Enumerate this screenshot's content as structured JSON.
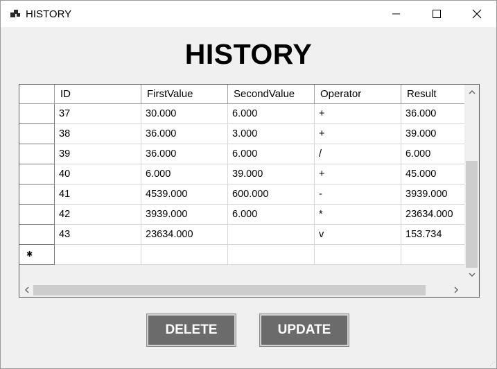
{
  "window": {
    "title": "HISTORY"
  },
  "heading": "HISTORY",
  "table": {
    "columns": [
      "ID",
      "FirstValue",
      "SecondValue",
      "Operator",
      "Result"
    ],
    "rows": [
      [
        "37",
        "30.000",
        "6.000",
        "+",
        "36.000"
      ],
      [
        "38",
        "36.000",
        "3.000",
        "+",
        "39.000"
      ],
      [
        "39",
        "36.000",
        "6.000",
        "/",
        "6.000"
      ],
      [
        "40",
        "6.000",
        "39.000",
        "+",
        "45.000"
      ],
      [
        "41",
        "4539.000",
        "600.000",
        "-",
        "3939.000"
      ],
      [
        "42",
        "3939.000",
        "6.000",
        "*",
        "23634.000"
      ],
      [
        "43",
        "23634.000",
        "",
        "v",
        "153.734"
      ]
    ],
    "new_row_marker": "✱"
  },
  "buttons": {
    "delete_label": "DELETE",
    "update_label": "UPDATE"
  },
  "icons": {
    "app": "app-icon",
    "minimize": "minimize-icon",
    "maximize": "maximize-icon",
    "close": "close-icon",
    "scroll_up": "chevron-up-icon",
    "scroll_down": "chevron-down-icon",
    "scroll_left": "chevron-left-icon",
    "scroll_right": "chevron-right-icon"
  },
  "colors": {
    "button_bg": "#6b6b6b",
    "button_text": "#ffffff",
    "window_bg": "#f0f0f0"
  }
}
